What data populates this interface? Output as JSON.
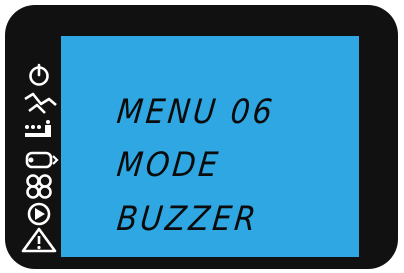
{
  "display": {
    "lines": [
      "MENU 06",
      "MODE",
      "BUZZER"
    ]
  },
  "icons": [
    "power-icon",
    "lightning-icon",
    "bluetooth-connection-icon",
    "fan-icon",
    "play-icon",
    "warning-icon"
  ],
  "colors": {
    "bezel": "#111111",
    "screen": "#2ea7e2",
    "segment_text": "#0b0b0b",
    "icon_white": "#ffffff"
  }
}
